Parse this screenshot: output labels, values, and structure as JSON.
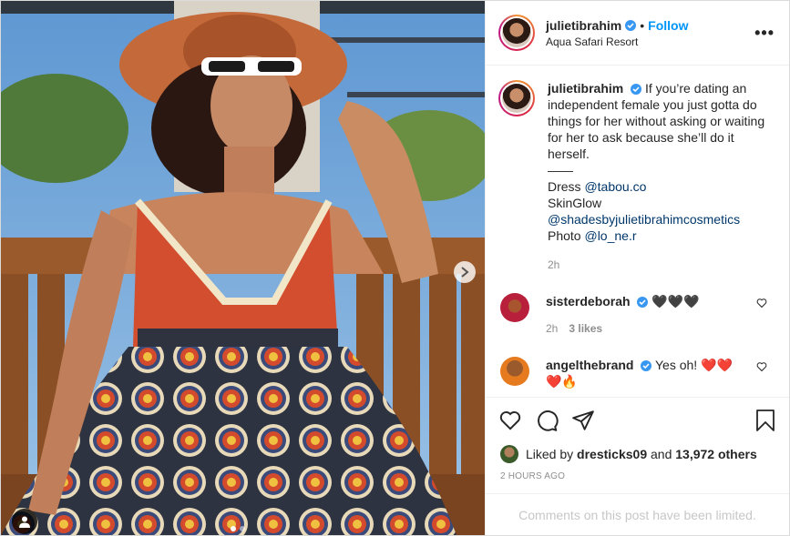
{
  "post": {
    "username": "julietibrahim",
    "location": "Aqua Safari Resort",
    "follow_label": "Follow",
    "more_icon": "more-options-icon",
    "caption_lines": [
      "If you’re dating an independent female you just gotta do things for her without asking or waiting for her to ask because she’ll do it herself."
    ],
    "divider": "——",
    "credits": {
      "dress_label": "Dress",
      "dress_link": "@tabou.co",
      "skin": "SkinGlow",
      "shades_link": "@shadesbyjulietibrahimcosmetics",
      "photo_label": "Photo",
      "photo_link": "@lo_ne.r"
    },
    "caption_time": "2h"
  },
  "comments": [
    {
      "username": "sisterdeborah",
      "text": "🖤🖤🖤",
      "time": "2h",
      "likes": "3 likes"
    },
    {
      "username": "angelthebrand",
      "text": "Yes oh! ❤️❤️❤️🔥",
      "time": "",
      "likes": ""
    }
  ],
  "likes": {
    "prefix": "Liked by",
    "first_user": "dresticks09",
    "and": "and",
    "others": "13,972 others"
  },
  "time_ago": "2 HOURS AGO",
  "comments_limited": "Comments on this post have been limited.",
  "carousel": {
    "count": 2,
    "active": 0
  },
  "colors": {
    "accent": "#0095f6",
    "verified": "#3897f0",
    "like_red": "#ed4956"
  }
}
